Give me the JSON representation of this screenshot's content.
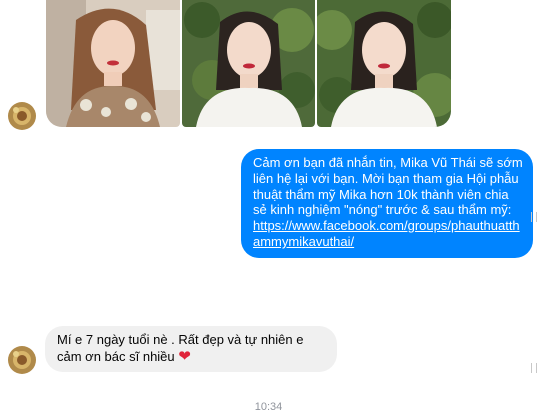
{
  "photos": [
    {
      "icon": "photo-woman-selfie-1"
    },
    {
      "icon": "photo-woman-selfie-2"
    },
    {
      "icon": "photo-woman-selfie-3"
    }
  ],
  "messages": {
    "outgoing": {
      "text": "Cảm ơn bạn đã nhắn tin, Mika Vũ Thái sẽ sớm liên hệ lại với bạn.  Mời bạn tham gia Hội phẫu thuật thẩm mỹ Mika hơn 10k thành viên chia sẻ kinh nghiệm \"nóng\" trước & sau  thẩm mỹ:",
      "link": "https://www.facebook.com/groups/phauthuatthammymikavuthai/"
    },
    "incoming": {
      "text": "Mí e 7 ngày tuổi nè . Rất đẹp và tự nhiên e cảm ơn bác sĩ nhiều",
      "emoji": "❤"
    }
  },
  "timestamp": "10:34",
  "colors": {
    "outgoing_bubble": "#0084ff",
    "incoming_bubble": "#f0f0f0",
    "heart": "#e0243b"
  }
}
